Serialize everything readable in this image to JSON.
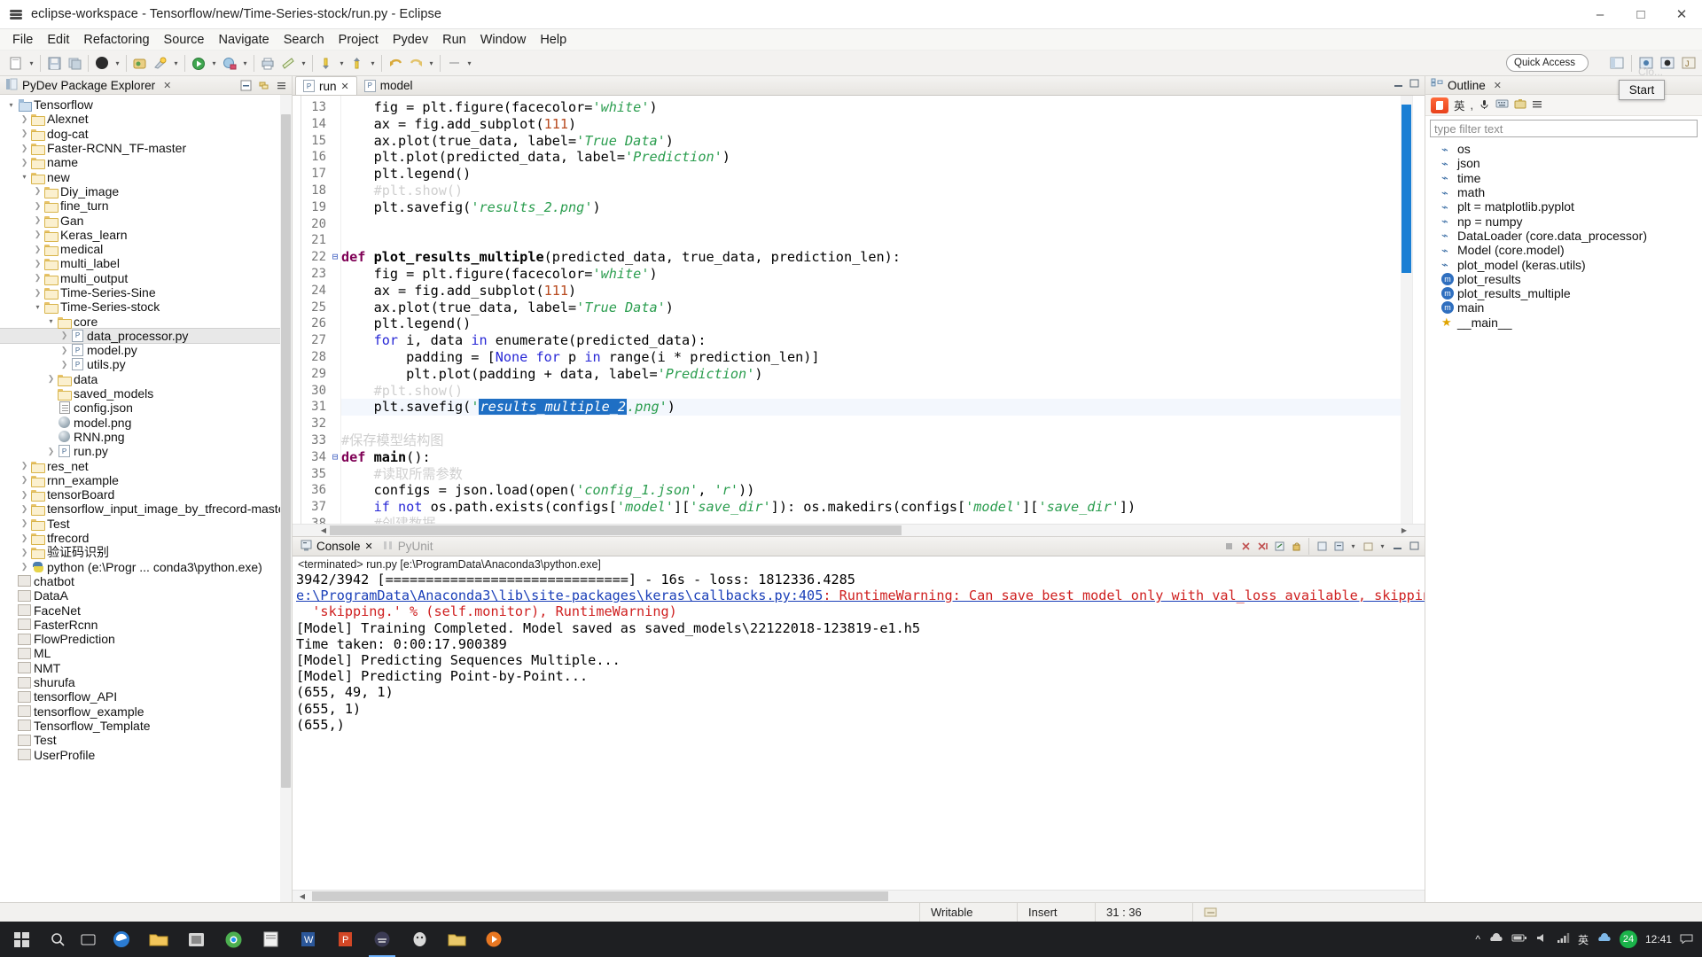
{
  "window": {
    "title": "eclipse-workspace - Tensorflow/new/Time-Series-stock/run.py - Eclipse",
    "minimize": "–",
    "maximize": "□",
    "close": "✕"
  },
  "menubar": [
    "File",
    "Edit",
    "Refactoring",
    "Source",
    "Navigate",
    "Search",
    "Project",
    "Pydev",
    "Run",
    "Window",
    "Help"
  ],
  "toolbar": {
    "quick_access": "Quick Access"
  },
  "explorer": {
    "title": "PyDev Package Explorer",
    "close": "✕",
    "items": [
      {
        "label": "Tensorflow",
        "indent": 0,
        "twist": "v",
        "icon": "project-icon"
      },
      {
        "label": "Alexnet",
        "indent": 1,
        "twist": ">",
        "icon": "folder-icon"
      },
      {
        "label": "dog-cat",
        "indent": 1,
        "twist": ">",
        "icon": "folder-icon"
      },
      {
        "label": "Faster-RCNN_TF-master",
        "indent": 1,
        "twist": ">",
        "icon": "folder-icon"
      },
      {
        "label": "name",
        "indent": 1,
        "twist": ">",
        "icon": "folder-icon"
      },
      {
        "label": "new",
        "indent": 1,
        "twist": "v",
        "icon": "folder-icon"
      },
      {
        "label": "Diy_image",
        "indent": 2,
        "twist": ">",
        "icon": "folder-icon"
      },
      {
        "label": "fine_turn",
        "indent": 2,
        "twist": ">",
        "icon": "folder-icon"
      },
      {
        "label": "Gan",
        "indent": 2,
        "twist": ">",
        "icon": "folder-icon"
      },
      {
        "label": "Keras_learn",
        "indent": 2,
        "twist": ">",
        "icon": "folder-icon"
      },
      {
        "label": "medical",
        "indent": 2,
        "twist": ">",
        "icon": "folder-icon"
      },
      {
        "label": "multi_label",
        "indent": 2,
        "twist": ">",
        "icon": "folder-icon"
      },
      {
        "label": "multi_output",
        "indent": 2,
        "twist": ">",
        "icon": "folder-icon"
      },
      {
        "label": "Time-Series-Sine",
        "indent": 2,
        "twist": ">",
        "icon": "folder-icon"
      },
      {
        "label": "Time-Series-stock",
        "indent": 2,
        "twist": "v",
        "icon": "folder-icon"
      },
      {
        "label": "core",
        "indent": 3,
        "twist": "v",
        "icon": "folder-icon"
      },
      {
        "label": "data_processor.py",
        "indent": 4,
        "twist": ">",
        "icon": "python-file-icon",
        "selected": true
      },
      {
        "label": "model.py",
        "indent": 4,
        "twist": ">",
        "icon": "python-file-icon"
      },
      {
        "label": "utils.py",
        "indent": 4,
        "twist": ">",
        "icon": "python-file-icon"
      },
      {
        "label": "data",
        "indent": 3,
        "twist": ">",
        "icon": "folder-icon"
      },
      {
        "label": "saved_models",
        "indent": 3,
        "twist": "",
        "icon": "folder-icon"
      },
      {
        "label": "config.json",
        "indent": 3,
        "twist": "",
        "icon": "json-file-icon"
      },
      {
        "label": "model.png",
        "indent": 3,
        "twist": "",
        "icon": "png-file-icon"
      },
      {
        "label": "RNN.png",
        "indent": 3,
        "twist": "",
        "icon": "png-file-icon"
      },
      {
        "label": "run.py",
        "indent": 3,
        "twist": ">",
        "icon": "python-file-icon"
      },
      {
        "label": "res_net",
        "indent": 1,
        "twist": ">",
        "icon": "folder-icon"
      },
      {
        "label": "rnn_example",
        "indent": 1,
        "twist": ">",
        "icon": "folder-icon"
      },
      {
        "label": "tensorBoard",
        "indent": 1,
        "twist": ">",
        "icon": "folder-icon"
      },
      {
        "label": "tensorflow_input_image_by_tfrecord-master",
        "indent": 1,
        "twist": ">",
        "icon": "folder-icon"
      },
      {
        "label": "Test",
        "indent": 1,
        "twist": ">",
        "icon": "folder-icon"
      },
      {
        "label": "tfrecord",
        "indent": 1,
        "twist": ">",
        "icon": "folder-icon"
      },
      {
        "label": "验证码识别",
        "indent": 1,
        "twist": ">",
        "icon": "folder-icon"
      },
      {
        "label": "python  (e:\\Progr ... conda3\\python.exe)",
        "indent": 1,
        "twist": ">",
        "icon": "python-interpreter-icon"
      },
      {
        "label": "chatbot",
        "indent": 0,
        "twist": "",
        "icon": "closed-project-icon"
      },
      {
        "label": "DataA",
        "indent": 0,
        "twist": "",
        "icon": "closed-project-icon"
      },
      {
        "label": "FaceNet",
        "indent": 0,
        "twist": "",
        "icon": "closed-project-icon"
      },
      {
        "label": "FasterRcnn",
        "indent": 0,
        "twist": "",
        "icon": "closed-project-icon"
      },
      {
        "label": "FlowPrediction",
        "indent": 0,
        "twist": "",
        "icon": "closed-project-icon"
      },
      {
        "label": "ML",
        "indent": 0,
        "twist": "",
        "icon": "closed-project-icon"
      },
      {
        "label": "NMT",
        "indent": 0,
        "twist": "",
        "icon": "closed-project-icon"
      },
      {
        "label": "shurufa",
        "indent": 0,
        "twist": "",
        "icon": "closed-project-icon"
      },
      {
        "label": "tensorflow_API",
        "indent": 0,
        "twist": "",
        "icon": "closed-project-icon"
      },
      {
        "label": "tensorflow_example",
        "indent": 0,
        "twist": "",
        "icon": "closed-project-icon"
      },
      {
        "label": "Tensorflow_Template",
        "indent": 0,
        "twist": "",
        "icon": "closed-project-icon"
      },
      {
        "label": "Test",
        "indent": 0,
        "twist": "",
        "icon": "closed-project-icon"
      },
      {
        "label": "UserProfile",
        "indent": 0,
        "twist": "",
        "icon": "closed-project-icon"
      }
    ]
  },
  "editor": {
    "tabs": [
      {
        "label": "run",
        "active": true,
        "close": "✕"
      },
      {
        "label": "model",
        "active": false,
        "close": ""
      }
    ],
    "lines": [
      {
        "num": "13",
        "fold": "",
        "html": "    fig = plt.figure(facecolor=<span class='s'>'white'</span>)"
      },
      {
        "num": "14",
        "fold": "",
        "html": "    ax = fig.add_subplot(<span class='n'>111</span>)"
      },
      {
        "num": "15",
        "fold": "",
        "html": "    ax.plot(true_data, label=<span class='s'>'True Data'</span>)"
      },
      {
        "num": "16",
        "fold": "",
        "html": "    plt.plot(predicted_data, label=<span class='s'>'Prediction'</span>)"
      },
      {
        "num": "17",
        "fold": "",
        "html": "    plt.legend()"
      },
      {
        "num": "18",
        "fold": "",
        "html": "    <span class='cm'>#plt.show()</span>"
      },
      {
        "num": "19",
        "fold": "",
        "html": "    plt.savefig(<span class='s'>'results_2.png'</span>)"
      },
      {
        "num": "20",
        "fold": "",
        "html": ""
      },
      {
        "num": "21",
        "fold": "",
        "html": ""
      },
      {
        "num": "22",
        "fold": "⊟",
        "html": "<span class='k'>def</span> <span class='fn'>plot_results_multiple</span>(predicted_data, true_data, prediction_len):"
      },
      {
        "num": "23",
        "fold": "",
        "html": "    fig = plt.figure(facecolor=<span class='s'>'white'</span>)"
      },
      {
        "num": "24",
        "fold": "",
        "html": "    ax = fig.add_subplot(<span class='n'>111</span>)"
      },
      {
        "num": "25",
        "fold": "",
        "html": "    ax.plot(true_data, label=<span class='s'>'True Data'</span>)"
      },
      {
        "num": "26",
        "fold": "",
        "html": "    plt.legend()"
      },
      {
        "num": "27",
        "fold": "",
        "html": "    <span class='kb'>for</span> i, data <span class='kb'>in</span> enumerate(predicted_data):"
      },
      {
        "num": "28",
        "fold": "",
        "html": "        padding = [<span class='kb'>None</span> <span class='kb'>for</span> p <span class='kb'>in</span> range(i * prediction_len)]"
      },
      {
        "num": "29",
        "fold": "",
        "html": "        plt.plot(padding + data, label=<span class='s'>'Prediction'</span>)"
      },
      {
        "num": "30",
        "fold": "",
        "html": "    <span class='cm'>#plt.show()</span>"
      },
      {
        "num": "31",
        "fold": "",
        "html": "    plt.savefig(<span class='s'>'</span><span class='sel-hl'>results_multiple_2</span><span class='s'>.png'</span>)",
        "current": true
      },
      {
        "num": "32",
        "fold": "",
        "html": ""
      },
      {
        "num": "33",
        "fold": "",
        "html": "<span class='cm'>#保存模型结构图</span>"
      },
      {
        "num": "34",
        "fold": "⊟",
        "html": "<span class='k'>def</span> <span class='fn'>main</span>():"
      },
      {
        "num": "35",
        "fold": "",
        "html": "    <span class='cm'>#读取所需参数</span>"
      },
      {
        "num": "36",
        "fold": "",
        "html": "    configs = json.load(open(<span class='s'>'config_1.json'</span>, <span class='s'>'r'</span>))"
      },
      {
        "num": "37",
        "fold": "",
        "html": "    <span class='kb'>if</span> <span class='kb'>not</span> os.path.exists(configs[<span class='s'>'model'</span>][<span class='s'>'save_dir'</span>]): os.makedirs(configs[<span class='s'>'model'</span>][<span class='s'>'save_dir'</span>])"
      },
      {
        "num": "38",
        "fold": "",
        "html": "    <span class='cm'>#创建数据</span>"
      }
    ]
  },
  "console": {
    "tabs": [
      {
        "label": "Console",
        "active": true,
        "close": "✕"
      },
      {
        "label": "PyUnit",
        "active": false,
        "close": ""
      }
    ],
    "terminated_header": "<terminated> run.py [e:\\ProgramData\\Anaconda3\\python.exe]",
    "lines": [
      {
        "text": "3942/3942 [==============================] - 16s - loss: 1812336.4285",
        "style": "plain"
      },
      {
        "text": "e:\\ProgramData\\Anaconda3\\lib\\site-packages\\keras\\callbacks.py:405",
        "style": "link",
        "suffix": ": RuntimeWarning: Can save best model only with val_loss available, skipping.",
        "suffix_style": "warn"
      },
      {
        "text": "  'skipping.' % (self.monitor), RuntimeWarning)",
        "style": "warn"
      },
      {
        "text": "[Model] Training Completed. Model saved as saved_models\\22122018-123819-e1.h5",
        "style": "plain"
      },
      {
        "text": "Time taken: 0:00:17.900389",
        "style": "plain"
      },
      {
        "text": "[Model] Predicting Sequences Multiple...",
        "style": "plain"
      },
      {
        "text": "[Model] Predicting Point-by-Point...",
        "style": "plain"
      },
      {
        "text": "(655, 49, 1)",
        "style": "plain"
      },
      {
        "text": "(655, 1)",
        "style": "plain"
      },
      {
        "text": "(655,)",
        "style": "plain"
      }
    ]
  },
  "outline": {
    "title": "Outline",
    "close": "✕",
    "filter_placeholder": "type filter text",
    "items": [
      {
        "label": "os",
        "icon": "import-icon"
      },
      {
        "label": "json",
        "icon": "import-icon"
      },
      {
        "label": "time",
        "icon": "import-icon"
      },
      {
        "label": "math",
        "icon": "import-icon"
      },
      {
        "label": "plt = matplotlib.pyplot",
        "icon": "import-icon"
      },
      {
        "label": "np = numpy",
        "icon": "import-icon"
      },
      {
        "label": "DataLoader (core.data_processor)",
        "icon": "import-icon"
      },
      {
        "label": "Model (core.model)",
        "icon": "import-icon"
      },
      {
        "label": "plot_model (keras.utils)",
        "icon": "import-icon"
      },
      {
        "label": "plot_results",
        "icon": "method-icon",
        "glyph": "m"
      },
      {
        "label": "plot_results_multiple",
        "icon": "method-icon",
        "glyph": "m"
      },
      {
        "label": "main",
        "icon": "method-icon",
        "glyph": "m"
      },
      {
        "label": "__main__",
        "icon": "star-icon"
      }
    ]
  },
  "tooltip": {
    "start_label": "Start",
    "ghost_label": "Clo..."
  },
  "ime": {
    "lang": "英"
  },
  "statusbar": {
    "writable": "Writable",
    "insert": "Insert",
    "position": "31 : 36"
  },
  "taskbar": {
    "clock_time": "12:41",
    "clock_date": "",
    "tray_count": "24"
  },
  "colors": {
    "accent": "#1f6fc4",
    "string_green": "#2a9d4e",
    "keyword_purple": "#7f0055",
    "warning_red": "#cf2020",
    "link_blue": "#1a3fb8"
  }
}
